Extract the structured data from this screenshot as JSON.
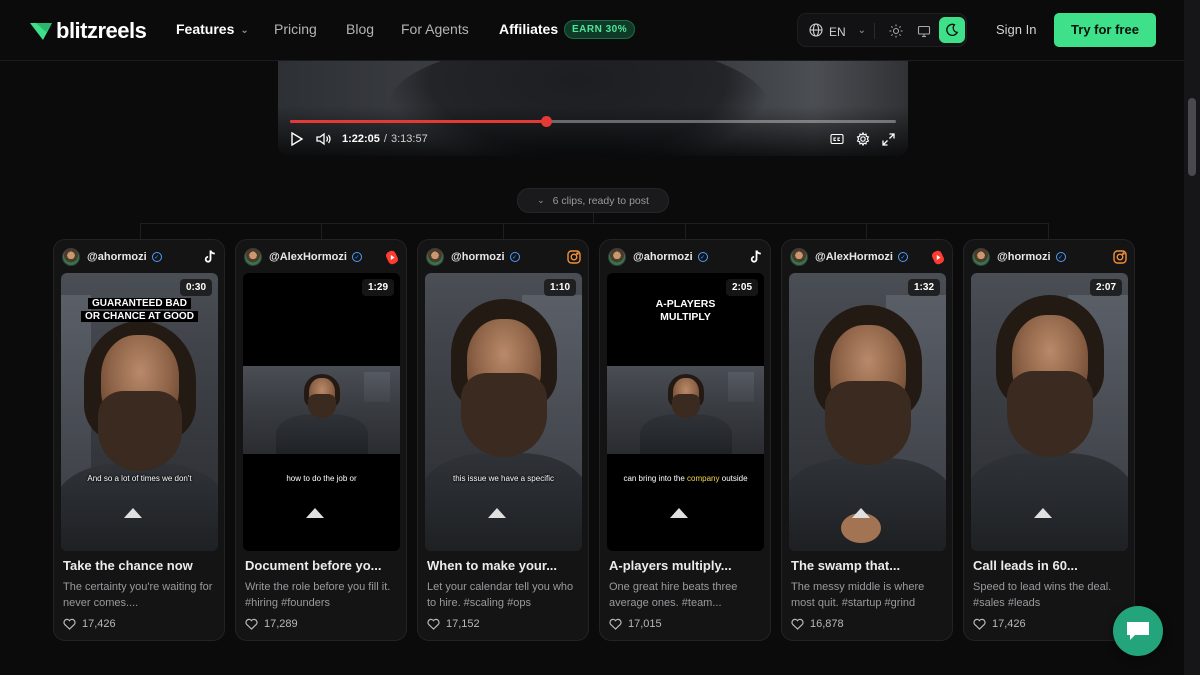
{
  "nav": {
    "logo_text": "blitzreels",
    "links": {
      "features": "Features",
      "pricing": "Pricing",
      "blog": "Blog",
      "agents": "For Agents",
      "affiliates": "Affiliates"
    },
    "earn_badge": "EARN 30%",
    "language": "EN",
    "signin": "Sign In",
    "cta": "Try for free"
  },
  "player": {
    "current_time": "1:22:05",
    "separator": "/",
    "total_time": "3:13:57",
    "progress_fraction": 0.4227
  },
  "clips_label": "6 clips, ready to post",
  "clips": [
    {
      "handle": "@ahormozi",
      "platform": "tiktok",
      "duration": "0:30",
      "overlay_line1": "GUARANTEED BAD",
      "overlay_line2": "OR CHANCE AT GOOD",
      "caption": "And so a lot of times we don't",
      "title": "Take the chance now",
      "description": "The certainty you're waiting for never comes....",
      "likes": "17,426"
    },
    {
      "handle": "@AlexHormozi",
      "platform": "youtube-shorts",
      "duration": "1:29",
      "overlay_line1": "",
      "overlay_line2": "",
      "caption": "how to do the job or",
      "title": "Document before yo...",
      "description": "Write the role before you fill it. #hiring #founders",
      "likes": "17,289"
    },
    {
      "handle": "@hormozi",
      "platform": "instagram",
      "duration": "1:10",
      "overlay_line1": "",
      "overlay_line2": "",
      "caption": "this issue we have a specific",
      "title": "When to make your...",
      "description": "Let your calendar tell you who to hire. #scaling #ops",
      "likes": "17,152"
    },
    {
      "handle": "@ahormozi",
      "platform": "tiktok",
      "duration": "2:05",
      "overlay_line1": "A-PLAYERS",
      "overlay_line2": "MULTIPLY",
      "caption_before": "can bring into the",
      "caption_highlight": "company",
      "caption_after": "outside",
      "title": "A-players multiply...",
      "description": "One great hire beats three average ones. #team...",
      "likes": "17,015"
    },
    {
      "handle": "@AlexHormozi",
      "platform": "youtube-shorts",
      "duration": "1:32",
      "title": "The swamp that...",
      "description": "The messy middle is where most quit. #startup #grind",
      "likes": "16,878"
    },
    {
      "handle": "@hormozi",
      "platform": "instagram",
      "duration": "2:07",
      "title": "Call leads in 60...",
      "description": "Speed to lead wins the deal. #sales #leads",
      "likes": "17,426"
    }
  ],
  "colors": {
    "accent_green": "#3ee08a",
    "progress_red": "#e53935",
    "verified_blue": "#4a9bff",
    "youtube_red": "#ff3b30",
    "instagram_orange": "#f0913a",
    "chat_green": "#24a47a"
  }
}
